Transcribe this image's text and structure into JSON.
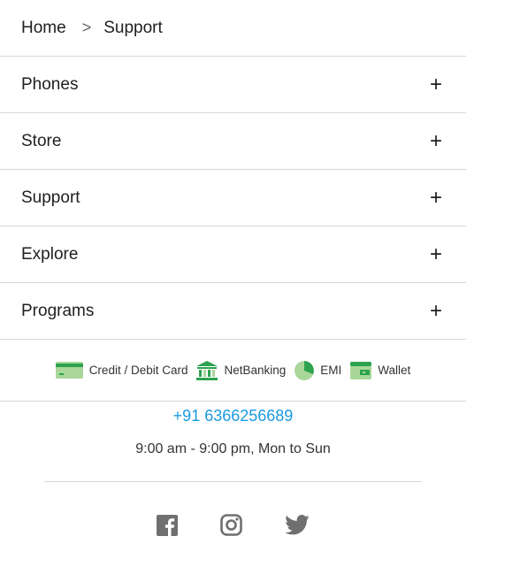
{
  "breadcrumb": {
    "home": "Home",
    "separator": ">",
    "current": "Support"
  },
  "accordion": [
    {
      "label": "Phones",
      "icon": "plus-icon"
    },
    {
      "label": "Store",
      "icon": "plus-icon"
    },
    {
      "label": "Support",
      "icon": "plus-icon"
    },
    {
      "label": "Explore",
      "icon": "plus-icon"
    },
    {
      "label": "Programs",
      "icon": "plus-icon"
    }
  ],
  "expand_symbol": "+",
  "payments": [
    {
      "label": "Credit / Debit Card",
      "icon": "credit-card-icon"
    },
    {
      "label": "NetBanking",
      "icon": "bank-icon"
    },
    {
      "label": "EMI",
      "icon": "pie-chart-icon"
    },
    {
      "label": "Wallet",
      "icon": "wallet-icon"
    }
  ],
  "contact": {
    "phone": "+91 6366256689",
    "hours": "9:00 am - 9:00 pm, Mon to Sun"
  },
  "social": [
    {
      "icon": "facebook-icon"
    },
    {
      "icon": "instagram-icon"
    },
    {
      "icon": "twitter-icon"
    }
  ],
  "colors": {
    "link": "#1a9ae0",
    "payment_green": "#2ea24f",
    "payment_light_green": "#a9d79b",
    "social_gray": "#6f6f6f",
    "divider": "#d6d6d6"
  }
}
